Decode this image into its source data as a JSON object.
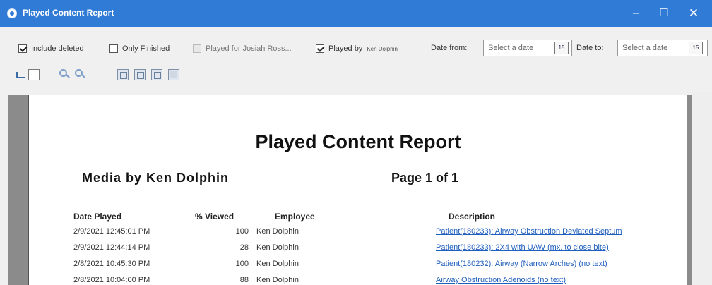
{
  "window": {
    "title": "Played Content Report",
    "controls": {
      "minimize": "–",
      "maximize": "☐",
      "close": "✕"
    }
  },
  "filters": {
    "include_deleted": {
      "label": "Include deleted",
      "checked": true
    },
    "only_finished": {
      "label": "Only Finished",
      "checked": false
    },
    "played_for": {
      "label": "Played for Josiah Ross...",
      "checked": false,
      "enabled": false
    },
    "played_by": {
      "label": "Played by",
      "name": "Ken Dolphin",
      "checked": true
    },
    "date_from": {
      "label": "Date from:",
      "placeholder": "Select a date",
      "icon_text": "15"
    },
    "date_to": {
      "label": "Date to:",
      "placeholder": "Select a date",
      "icon_text": "15"
    }
  },
  "toolbar": {
    "icons": [
      "back-icon",
      "page-icon",
      "zoom-in-icon",
      "zoom-out-icon",
      "layout-grid-icon",
      "layout-list-icon",
      "layout-split-icon",
      "layout-full-icon"
    ]
  },
  "report": {
    "title": "Played Content Report",
    "subtitle": "Media by Ken Dolphin",
    "page_info": "Page 1 of 1",
    "columns": {
      "date_played": "Date Played",
      "viewed": "% Viewed",
      "employee": "Employee",
      "description": "Description"
    },
    "rows": [
      {
        "date": "2/9/2021 12:45:01 PM",
        "viewed": "100",
        "employee": "Ken Dolphin",
        "description": "Patient(180233): Airway Obstruction Deviated Septum"
      },
      {
        "date": "2/9/2021 12:44:14 PM",
        "viewed": "28",
        "employee": "Ken Dolphin",
        "description": "Patient(180233): 2X4 with UAW (mx. to close bite)"
      },
      {
        "date": "2/8/2021 10:45:30 PM",
        "viewed": "100",
        "employee": "Ken Dolphin",
        "description": "Patient(180232): Airway (Narrow Arches) (no text)"
      },
      {
        "date": "2/8/2021 10:04:00 PM",
        "viewed": "88",
        "employee": "Ken Dolphin",
        "description": "Airway Obstruction Adenoids (no text)"
      }
    ]
  },
  "colors": {
    "titlebar": "#2f7bd6",
    "link": "#1f5fbf",
    "viewer_background": "#8b8b8b"
  }
}
